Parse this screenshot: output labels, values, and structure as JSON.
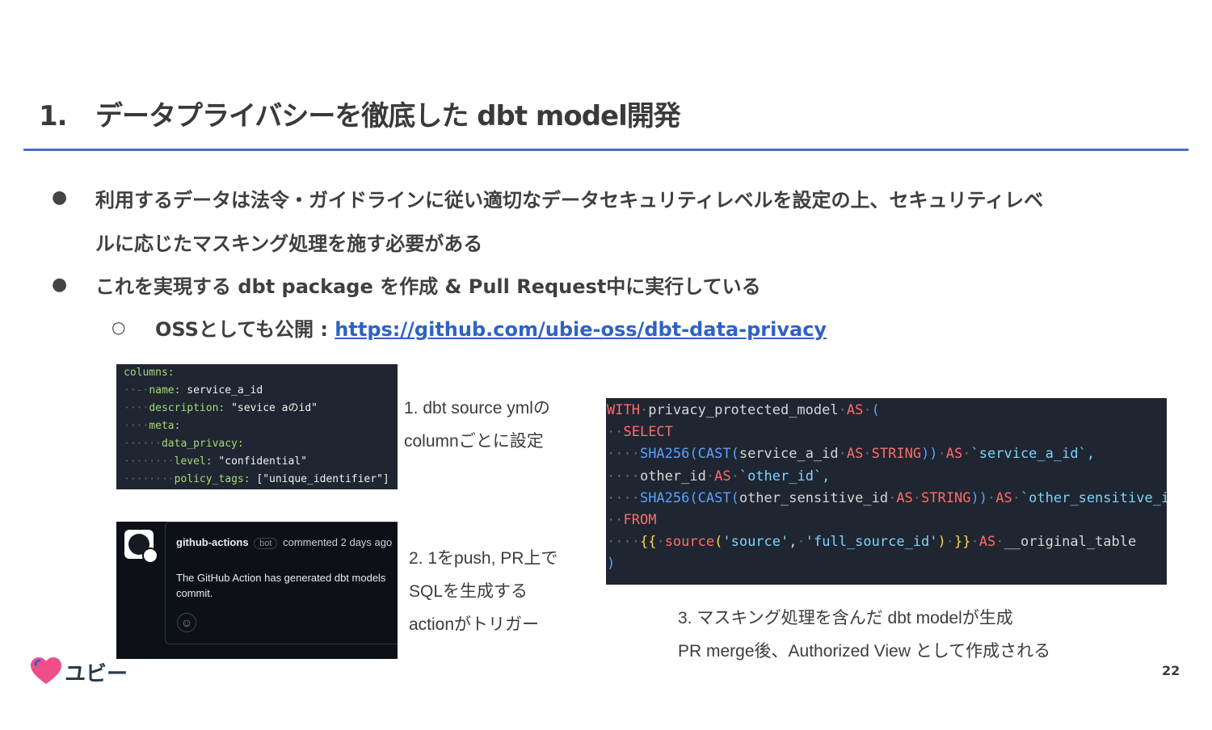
{
  "slide": {
    "title_number": "1.",
    "title_text": "データプライバシーを徹底した dbt model開発",
    "bullets": [
      {
        "line1": "利用するデータは法令・ガイドラインに従い適切なデータセキュリティレベルを設定の上、セキュリティレベ",
        "line2": "ルに応じたマスキング処理を施す必要がある"
      },
      {
        "line1": "これを実現する dbt package を作成 & Pull Request中に実行している"
      }
    ],
    "sub_bullet_prefix": "OSSとしても公開 : ",
    "sub_bullet_link": "https://github.com/ubie-oss/dbt-data-privacy",
    "page_number": "22",
    "logo_text": "ユビー",
    "brand_color": "#f04e8a",
    "accent_color": "#4a6cc5"
  },
  "yml_snippet": {
    "lines": [
      {
        "indent": "",
        "key": "columns:",
        "value": ""
      },
      {
        "indent": "··-·",
        "key": "name:",
        "value": "service_a_id"
      },
      {
        "indent": "····",
        "key": "description:",
        "value": "\"sevice aのid\""
      },
      {
        "indent": "····",
        "key": "meta:",
        "value": ""
      },
      {
        "indent": "······",
        "key": "data_privacy:",
        "value": ""
      },
      {
        "indent": "········",
        "key": "level:",
        "value": "\"confidential\""
      },
      {
        "indent": "········",
        "key": "policy_tags:",
        "value": "[\"unique_identifier\"]"
      }
    ]
  },
  "github_comment": {
    "author": "github-actions",
    "badge": "bot",
    "meta": "commented 2 days ago",
    "body_line1": "The GitHub Action has generated dbt models",
    "body_line2": "commit.",
    "reaction_icon": "smiley-icon"
  },
  "sql_snippet": {
    "with_kw": "WITH",
    "model": "privacy_protected_model",
    "as_kw": "AS",
    "open": "(",
    "select_kw": "SELECT",
    "line3_fn1": "SHA256",
    "line3_fn2": "CAST",
    "line3_col": "service_a_id",
    "line3_type": "STRING",
    "line3_alias": "`service_a_id`,",
    "line4_col": "other_id",
    "line4_alias": "`other_id`,",
    "line5_col": "other_sensitive_id",
    "line5_alias": "`other_sensitive_id`,",
    "from_kw": "FROM",
    "source_fn": "source",
    "source_arg1": "'source'",
    "source_arg2": "'full_source_id'",
    "table_alias": "__original_table",
    "close": ")"
  },
  "captions": {
    "cap1_line1": "1. dbt source ymlの",
    "cap1_line2": "columnごとに設定",
    "cap2_line1": "2. 1をpush, PR上で",
    "cap2_line2": "SQLを生成する",
    "cap2_line3": "actionがトリガー",
    "cap3_line1": "3. マスキング処理を含んだ dbt modelが生成",
    "cap3_line2": "PR merge後、Authorized View として作成される"
  }
}
